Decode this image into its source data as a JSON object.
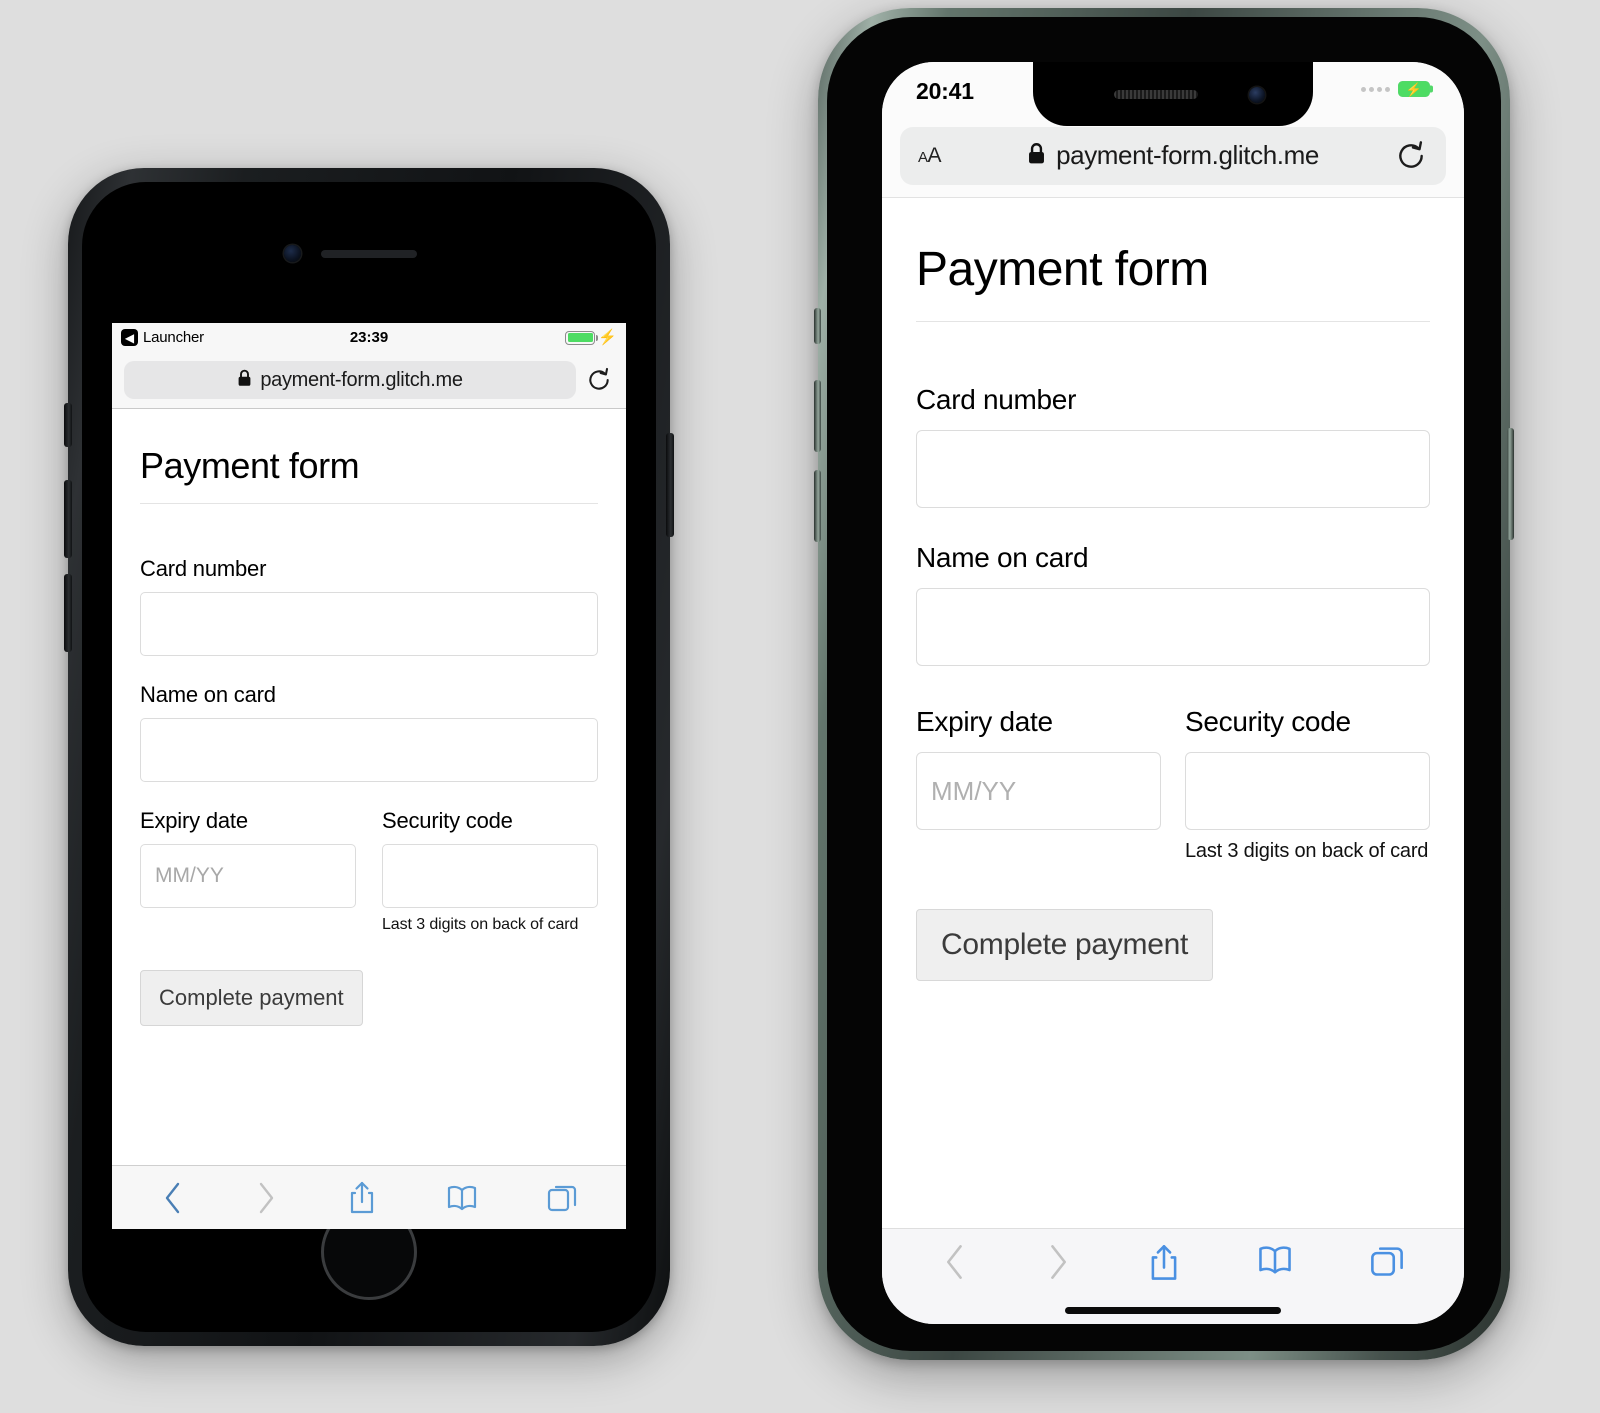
{
  "background_color": "#dedede",
  "phones": [
    {
      "id": "left",
      "model_style": "iphone-8-black",
      "status_bar": {
        "back_label": "Launcher",
        "back_icon": "chevron-left-icon",
        "time": "23:39",
        "battery_icon": "battery-charging-icon",
        "bolt_icon": "lightning-bolt-icon"
      },
      "browser": {
        "lock_icon": "lock-icon",
        "url": "payment-form.glitch.me",
        "reload_icon": "reload-icon"
      },
      "page": {
        "title": "Payment form",
        "fields": [
          {
            "label": "Card number",
            "value": "",
            "placeholder": ""
          },
          {
            "label": "Name on card",
            "value": "",
            "placeholder": ""
          }
        ],
        "expiry": {
          "label": "Expiry date",
          "value": "",
          "placeholder": "MM/YY"
        },
        "security": {
          "label": "Security code",
          "value": "",
          "placeholder": "",
          "hint": "Last 3 digits on back of card"
        },
        "submit_label": "Complete payment"
      },
      "toolbar": {
        "back_icon": "chevron-left-icon",
        "forward_icon": "chevron-right-icon",
        "share_icon": "share-icon",
        "bookmarks_icon": "book-icon",
        "tabs_icon": "tabs-icon",
        "back_enabled_color": "#4a7fb5",
        "forward_disabled_color": "#c2c2c2",
        "active_color": "#5b9bd5"
      }
    },
    {
      "id": "right",
      "model_style": "iphone-11-pro-midnight-green",
      "status_bar": {
        "time": "20:41",
        "signal_icon": "signal-dots-icon",
        "battery_icon": "battery-charging-icon"
      },
      "browser": {
        "text_size_label": "AA",
        "lock_icon": "lock-icon",
        "url": "payment-form.glitch.me",
        "reload_icon": "reload-icon"
      },
      "page": {
        "title": "Payment form",
        "fields": [
          {
            "label": "Card number",
            "value": "",
            "placeholder": ""
          },
          {
            "label": "Name on card",
            "value": "",
            "placeholder": ""
          }
        ],
        "expiry": {
          "label": "Expiry date",
          "value": "",
          "placeholder": "MM/YY"
        },
        "security": {
          "label": "Security code",
          "value": "",
          "placeholder": "",
          "hint": "Last 3 digits on back of card"
        },
        "submit_label": "Complete payment"
      },
      "toolbar": {
        "back_icon": "chevron-left-icon",
        "forward_icon": "chevron-right-icon",
        "share_icon": "share-icon",
        "bookmarks_icon": "book-icon",
        "tabs_icon": "tabs-icon",
        "back_disabled_color": "#c2c2c2",
        "forward_disabled_color": "#c2c2c2",
        "active_color": "#4a90e2"
      }
    }
  ]
}
